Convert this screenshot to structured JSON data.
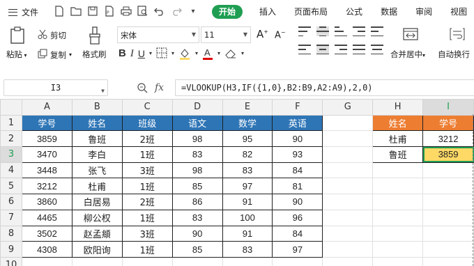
{
  "menubar": {
    "file_label": "文件",
    "tabs": [
      "开始",
      "插入",
      "页面布局",
      "公式",
      "数据",
      "审阅",
      "视图"
    ],
    "active_tab": "开始"
  },
  "ribbon": {
    "paste_label": "粘贴",
    "cut_label": "剪切",
    "copy_label": "复制",
    "format_painter_label": "格式刷",
    "font_name": "宋体",
    "font_size": "11",
    "merge_label": "合并居中",
    "wrap_label": "自动换行"
  },
  "formula_bar": {
    "name_box": "I3",
    "fx_label": "fx",
    "formula": "=VLOOKUP(H3,IF({1,0},B2:B9,A2:A9),2,0)"
  },
  "sheet": {
    "columns": [
      "A",
      "B",
      "C",
      "D",
      "E",
      "F",
      "G",
      "H",
      "I"
    ],
    "rows": [
      "1",
      "2",
      "3",
      "4",
      "5",
      "6",
      "7",
      "8",
      "9",
      "10"
    ],
    "table_headers": [
      "学号",
      "姓名",
      "班级",
      "语文",
      "数学",
      "英语"
    ],
    "table_rows": [
      [
        "3859",
        "鲁班",
        "2班",
        "98",
        "95",
        "90"
      ],
      [
        "3470",
        "李白",
        "1班",
        "83",
        "82",
        "93"
      ],
      [
        "3448",
        "张飞",
        "3班",
        "98",
        "83",
        "84"
      ],
      [
        "3212",
        "杜甫",
        "1班",
        "85",
        "97",
        "81"
      ],
      [
        "3860",
        "白居易",
        "2班",
        "86",
        "91",
        "90"
      ],
      [
        "4465",
        "柳公权",
        "1班",
        "83",
        "100",
        "96"
      ],
      [
        "3502",
        "赵孟頫",
        "3班",
        "90",
        "91",
        "84"
      ],
      [
        "4308",
        "欧阳询",
        "1班",
        "85",
        "83",
        "97"
      ]
    ],
    "lookup_headers": [
      "姓名",
      "学号"
    ],
    "lookup_rows": [
      [
        "杜甫",
        "3212"
      ],
      [
        "鲁班",
        "3859"
      ]
    ],
    "selected_cell": "I3",
    "colors": {
      "header_blue": "#2e75b6",
      "header_orange": "#ed7d31",
      "selected_fill": "#ffd966",
      "accent_green": "#1f9e52"
    }
  }
}
